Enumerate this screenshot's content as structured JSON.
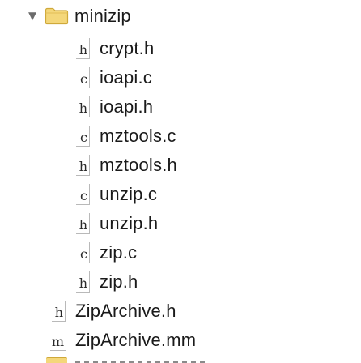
{
  "tree": {
    "folder": {
      "name": "minizip",
      "expanded": true,
      "disclosure_glyph": "▼",
      "icon": "folder-icon",
      "icon_color": "#f4d77a"
    },
    "children": [
      {
        "icon_letter": "h",
        "name": "crypt.h"
      },
      {
        "icon_letter": "c",
        "name": "ioapi.c"
      },
      {
        "icon_letter": "h",
        "name": "ioapi.h"
      },
      {
        "icon_letter": "c",
        "name": "mztools.c"
      },
      {
        "icon_letter": "h",
        "name": "mztools.h"
      },
      {
        "icon_letter": "c",
        "name": "unzip.c"
      },
      {
        "icon_letter": "h",
        "name": "unzip.h"
      },
      {
        "icon_letter": "c",
        "name": "zip.c"
      },
      {
        "icon_letter": "h",
        "name": "zip.h"
      }
    ],
    "siblings": [
      {
        "icon_letter": "h",
        "name": "ZipArchive.h"
      },
      {
        "icon_letter": "m",
        "name": "ZipArchive.mm"
      }
    ]
  }
}
